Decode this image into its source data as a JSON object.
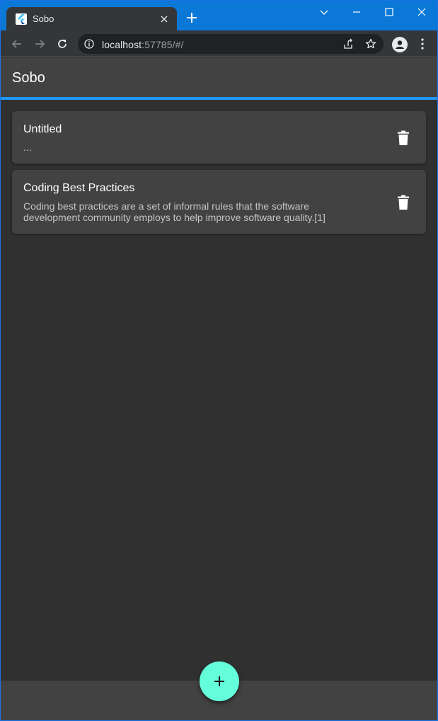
{
  "browser": {
    "tab_title": "Sobo",
    "url_host": "localhost",
    "url_rest": ":57785/#/"
  },
  "app": {
    "title": "Sobo",
    "notes": [
      {
        "title": "Untitled",
        "body": "..."
      },
      {
        "title": "Coding Best Practices",
        "body": "Coding best practices are a set of informal rules that the software development community employs to help improve software quality.[1]"
      }
    ]
  },
  "colors": {
    "accent": "#2196f3",
    "fab": "#64ffda",
    "surface": "#424242",
    "background": "#303030",
    "titlebar": "#0b78d7"
  },
  "icons": {
    "fab": "add-icon",
    "note_action": "trash-icon"
  }
}
